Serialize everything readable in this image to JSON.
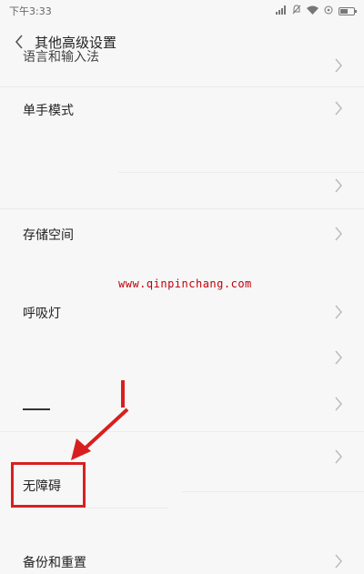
{
  "status_bar": {
    "time": "下午3:33",
    "icons": [
      "signal-icon",
      "mute-icon",
      "wifi-icon",
      "alarm-icon",
      "battery-icon"
    ]
  },
  "header": {
    "title": "其他高级设置",
    "back_icon": "back-chevron-icon"
  },
  "list": {
    "items": [
      {
        "label": "语言和输入法"
      },
      {
        "label": "单手模式"
      },
      {
        "label": ""
      },
      {
        "label": "存储空间"
      },
      {
        "label": "呼吸灯"
      },
      {
        "label": ""
      },
      {
        "label": ""
      },
      {
        "label": ""
      },
      {
        "label": "无障碍"
      },
      {
        "label": "备份和重置"
      }
    ]
  },
  "watermark": "www.qinpinchang.com",
  "annotation": {
    "color": "#d81f1f"
  }
}
